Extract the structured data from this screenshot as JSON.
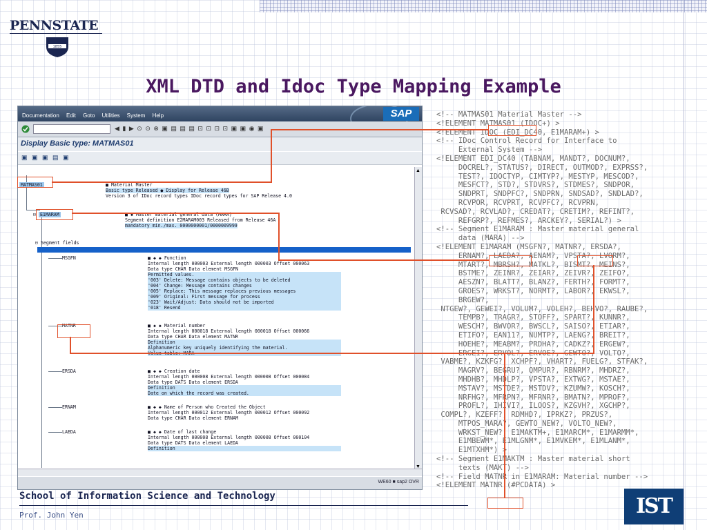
{
  "logo": {
    "name": "PENNSTATE",
    "year": "1855"
  },
  "title": "XML DTD and Idoc Type Mapping Example",
  "sap": {
    "menu": [
      "Documentation",
      "Edit",
      "Goto",
      "Utilities",
      "System",
      "Help"
    ],
    "logo": "SAP",
    "window_title": "Display Basic type: MATMAS01",
    "tree": {
      "root": "MATMAS01",
      "root_desc": "■ Material Master",
      "root_line2": "Basic type Released ● Display for Release 46B",
      "root_line3": "Version 3 of IDoc record types IDoc record types for SAP Release 4.0",
      "segment": "E1MARAM",
      "segment_desc": "■ ◆ Master material general data (MARA)",
      "segment_line2": "Segment definition E2MARAM003 Released from Release 46A",
      "segment_line3": "mandatory min./max. 0000000001/0000009999",
      "segment_fields": "Segment fields",
      "fields": [
        {
          "name": "MSGFN",
          "lines": [
            "■ ◆ ◆ Function",
            "Internal length 000003 External length 000003 Offset 000063",
            "Data type CHAR Data element MSGFN",
            "Permitted values.",
            "'003' Delete: Message contains objects to be deleted",
            "'004' Change: Message contains changes",
            "'005' Replace: This message replaces previous messages",
            "'009' Original: First message for process",
            "'023' Wait/Adjust: Data should not be imported",
            "'018' Resend"
          ]
        },
        {
          "name": "MATNR",
          "lines": [
            "■ ◆ ◆ Material number",
            "Internal length 000018 External length 000018 Offset 000066",
            "Data type CHAR Data element MATNR",
            "Definition",
            "Alphanumeric key uniquely identifying the material.",
            "Value table: MARA"
          ]
        },
        {
          "name": "ERSDA",
          "lines": [
            "■ ◆ ◆ Creation date",
            "Internal length 000008 External length 000008 Offset 000084",
            "Data type DATS Data element ERSDA",
            "Definition",
            "Date on which the record was created."
          ]
        },
        {
          "name": "ERNAM",
          "lines": [
            "■ ◆ ◆ Name of Person who Created the Object",
            "Internal length 000012 External length 000012 Offset 000092",
            "Data type CHAR Data element ERNAM"
          ]
        },
        {
          "name": "LAEDA",
          "lines": [
            "■ ◆ ◆ Date of last change",
            "Internal length 000008 External length 000008 Offset 000104",
            "Data type DATS Data element LAEDA",
            "Definition"
          ]
        }
      ]
    },
    "status": "WE60 ■ sap2 OVR"
  },
  "code": [
    "<!-- MATMAS01 Material Master -->",
    "<!ELEMENT MATMAS01 (IDOC+) >",
    "<!ELEMENT IDOC (EDI_DC40, E1MARAM+) >",
    "<!-- IDoc Control Record for Interface to",
    "     External System -->",
    "<!ELEMENT EDI_DC40 (TABNAM, MANDT?, DOCNUM?,",
    "     DOCREL?, STATUS?, DIRECT, OUTMOD?, EXPRSS?,",
    "     TEST?, IDOCTYP, CIMTYP?, MESTYP, MESCOD?,",
    "     MESFCT?, STD?, STDVRS?, STDMES?, SNDPOR,",
    "     SNDPRT, SNDPFC?, SNDPRN, SNDSAD?, SNDLAD?,",
    "     RCVPOR, RCVPRT, RCVPFC?, RCVPRN,",
    " RCVSAD?, RCVLAD?, CREDAT?, CRETIM?, REFINT?,",
    "     REFGRP?, REFMES?, ARCKEY?, SERIAL?) >",
    "<!-- Segment E1MARAM : Master material general",
    "     data (MARA) -->",
    "<!ELEMENT E1MARAM (MSGFN?, MATNR?, ERSDA?,",
    "     ERNAM?, LAEDA?, AENAM?, VPSTA?, LVORM?,",
    "     MTART?, MBRSH?, MATKL?, BISMT?, MEINS?,",
    "     BSTME?, ZEINR?, ZEIAR?, ZEIVR?, ZEIFO?,",
    "     AESZN?, BLATT?, BLANZ?, FERTH?, FORMT?,",
    "     GROES?, WRKST?, NORMT?, LABOR?, EKWSL?,",
    "     BRGEW?,",
    " NTGEW?, GEWEI?, VOLUM?, VOLEH?, BEHVO?, RAUBE?,",
    "     TEMPB?, TRAGR?, STOFF?, SPART?, KUNNR?,",
    "     WESCH?, BWVOR?, BWSCL?, SAISO?, ETIAR?,",
    "     ETIFO?, EAN11?, NUMTP?, LAENG?, BREIT?,",
    "     HOEHE?, MEABM?, PRDHA?, CADKZ?, ERGEW?,",
    "     ERGEI?, ERVOL?, ERVOE?, GEWTO?, VOLTO?,",
    " VABME?, KZKFG?, XCHPF?, VHART?, FUELG?, STFAK?,",
    "     MAGRV?, BEGRU?, QMPUR?, RBNRM?, MHDRZ?,",
    "     MHDHB?, MHDLP?, VPSTA?, EXTWG?, MSTAE?,",
    "     MSTAV?, MSTDE?, MSTDV?, KZUMW?, KOSCH?,",
    "     NRFHG?, MFRPN?, MFRNR?, BMATN?, MPROF?,",
    "     PROFL?, IHIVI?, ILOOS?, KZGVH?, XGCHP?,",
    " COMPL?, KZEFF?, RDMHD?, IPRKZ?, PRZUS?,",
    "     MTPOS_MARA?, GEWTO_NEW?, VOLTO_NEW?,",
    "     WRKST_NEW?, E1MAKTM+, E1MARCM*, E1MARMM*,",
    "     E1MBEWM*, E1MLGNM*, E1MVKEM*, E1MLANM*,",
    "     E1MTXHM*) >",
    "<!-- Segment E1MAKTM : Master material short",
    "     texts (MAKT) -->",
    "<!-- Field MATNR in E1MARAM: Material number -->",
    "<!ELEMENT MATNR (#PCDATA) >"
  ],
  "footer": {
    "school": "School of Information Science and Technology",
    "author": "Prof. John Yen",
    "logo": "IST"
  },
  "colors": {
    "title": "#4a1860",
    "callout": "#e0502a",
    "segment_bar": "#1561c9"
  }
}
